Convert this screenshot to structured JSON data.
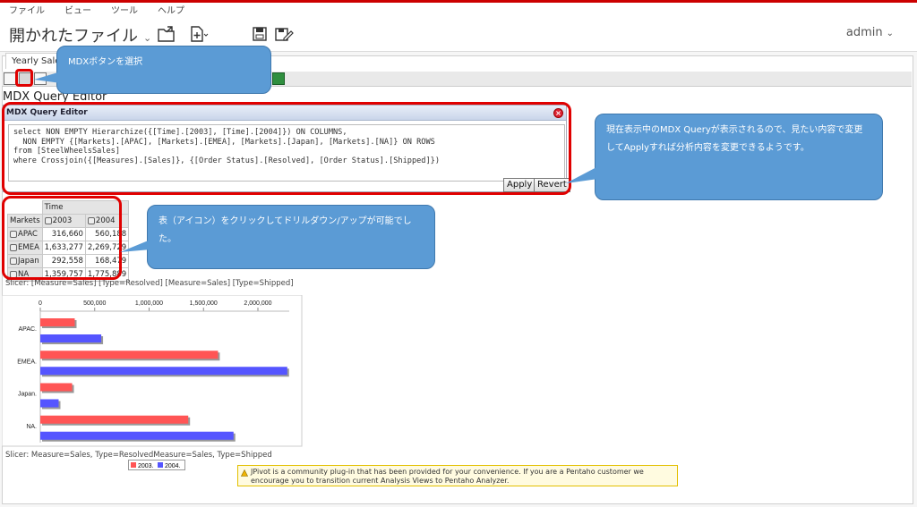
{
  "menu": [
    "ファイル",
    "ビュー",
    "ツール",
    "ヘルプ"
  ],
  "header": {
    "title": "開かれたファイル",
    "user": "admin"
  },
  "tab": {
    "label": "Yearly Sales"
  },
  "heading": "MDX Query Editor",
  "mdx": {
    "panel_title": "MDX Query Editor",
    "query": "select NON EMPTY Hierarchize({[Time].[2003], [Time].[2004]}) ON COLUMNS,\n  NON EMPTY {[Markets].[APAC], [Markets].[EMEA], [Markets].[Japan], [Markets].[NA]} ON ROWS\nfrom [SteelWheelsSales]\nwhere Crossjoin({[Measures].[Sales]}, {[Order Status].[Resolved], [Order Status].[Shipped]})",
    "apply": "Apply",
    "revert": "Revert"
  },
  "pivot": {
    "col_dim": "Time",
    "row_dim": "Markets",
    "columns": [
      "2003",
      "2004"
    ],
    "rows": [
      {
        "label": "APAC",
        "v": [
          "316,660",
          "560,188"
        ]
      },
      {
        "label": "EMEA",
        "v": [
          "1,633,277",
          "2,269,729"
        ]
      },
      {
        "label": "Japan",
        "v": [
          "292,558",
          "168,479"
        ]
      },
      {
        "label": "NA",
        "v": [
          "1,359,757",
          "1,775,889"
        ]
      }
    ]
  },
  "slicer_top": "Slicer: [Measure=Sales] [Type=Resolved] [Measure=Sales] [Type=Shipped]",
  "slicer_bottom": "Slicer: Measure=Sales, Type=ResolvedMeasure=Sales, Type=Shipped",
  "callouts": {
    "mdx_button": "MDXボタンを選択",
    "query": "現在表示中のMDX Queryが表示されるので、見たい内容で変更してApplyすれば分析内容を変更できるようです。",
    "drill": "表（アイコン）をクリックしてドリルダウン/アップが可能でした。"
  },
  "warning": "JPivot is a community plug-in that has been provided for your convenience. If you are a Pentaho customer we encourage you to transition current Analysis Views to Pentaho Analyzer.",
  "colors": {
    "series_2003": "#ff5555",
    "series_2004": "#5555ff",
    "callout": "#5b9bd5",
    "highlight": "#e00000"
  },
  "chart_data": {
    "type": "bar",
    "orientation": "horizontal",
    "categories": [
      "APAC.",
      "EMEA.",
      "Japan.",
      "NA."
    ],
    "series": [
      {
        "name": "2003.",
        "values": [
          316660,
          1633277,
          292558,
          1359757
        ]
      },
      {
        "name": "2004.",
        "values": [
          560188,
          2269729,
          168479,
          1775889
        ]
      }
    ],
    "x_ticks": [
      "0",
      "500,000",
      "1,000,000",
      "1,500,000",
      "2,000,000"
    ],
    "xlim": [
      0,
      2000000
    ],
    "legend_position": "bottom"
  }
}
